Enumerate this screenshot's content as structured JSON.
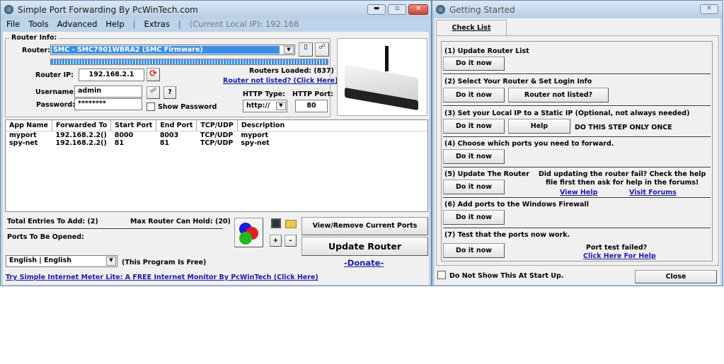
{
  "main": {
    "title": "Simple Port Forwarding By PcWinTech.com",
    "menu": [
      "File",
      "Tools",
      "Advanced",
      "Help",
      "|",
      "Extras",
      "|",
      "(Current Local IP): 192.168"
    ],
    "router_info_label": "Router Info:",
    "router_label": "Router:",
    "router_value": "SMC - SMC7901WBRA2 (SMC Firmware)",
    "router_ip_label": "Router IP:",
    "router_ip": "192.168.2.1",
    "username_label": "Username:",
    "username": "admin",
    "password_label": "Password:",
    "password": "********",
    "show_password": "Show Password",
    "help_q": "?",
    "routers_loaded": "Routers Loaded: (837)",
    "router_not_listed": "Router not listed? (Click Here)",
    "http_type_label": "HTTP Type:",
    "http_type": "http://",
    "http_port_label": "HTTP Port:",
    "http_port": "80",
    "table": {
      "headers": [
        "App Name",
        "Forwarded To",
        "Start Port",
        "End Port",
        "TCP/UDP",
        "Description"
      ],
      "rows": [
        [
          "myport",
          "192.168.2.2()",
          "8000",
          "8003",
          "TCP/UDP",
          "myport"
        ],
        [
          "spy-net",
          "192.168.2.2()",
          "81",
          "81",
          "TCP/UDP",
          "spy-net"
        ]
      ]
    },
    "total_entries": "Total Entries To Add: (2)",
    "max_router": "Max Router Can Hold: (20)",
    "ports_opened": "Ports To Be Opened:",
    "plus": "+",
    "minus": "-",
    "view_remove": "View/Remove Current Ports",
    "update_router": "Update Router",
    "language": "English | English",
    "free": "(This Program Is Free)",
    "donate": "-Donate-",
    "promo": "Try Simple Internet Meter Lite: A FREE Internet Monitor By PcWinTech (Click Here)"
  },
  "dialog": {
    "title": "Getting Started",
    "tab": "Check List",
    "steps": [
      {
        "title": "(1) Update Router List",
        "button": "Do it now"
      },
      {
        "title": "(2) Select Your Router & Set Login Info",
        "button": "Do it now",
        "extra_button": "Router not listed?"
      },
      {
        "title": "(3) Set your Local IP to a Static IP (Optional, not always needed)",
        "button": "Do it now",
        "extra_button": "Help",
        "note": "DO THIS STEP ONLY ONCE"
      },
      {
        "title": "(4) Choose which ports you need to forward.",
        "button": "Do it now"
      },
      {
        "title": "(5) Update The Router",
        "button": "Do it now",
        "note1": "Did updating the router fail? Check the help",
        "note2": "file first then ask for help in the forums!",
        "link1": "View Help",
        "link2": "Visit Forums"
      },
      {
        "title": "(6) Add ports to the Windows Firewall",
        "button": "Do it now"
      },
      {
        "title": "(7) Test that the ports now work.",
        "button": "Do it now",
        "note": "Port test failed?",
        "link": "Click Here For Help"
      }
    ],
    "dont_show": "Do Not Show This At Start Up.",
    "close": "Close"
  }
}
